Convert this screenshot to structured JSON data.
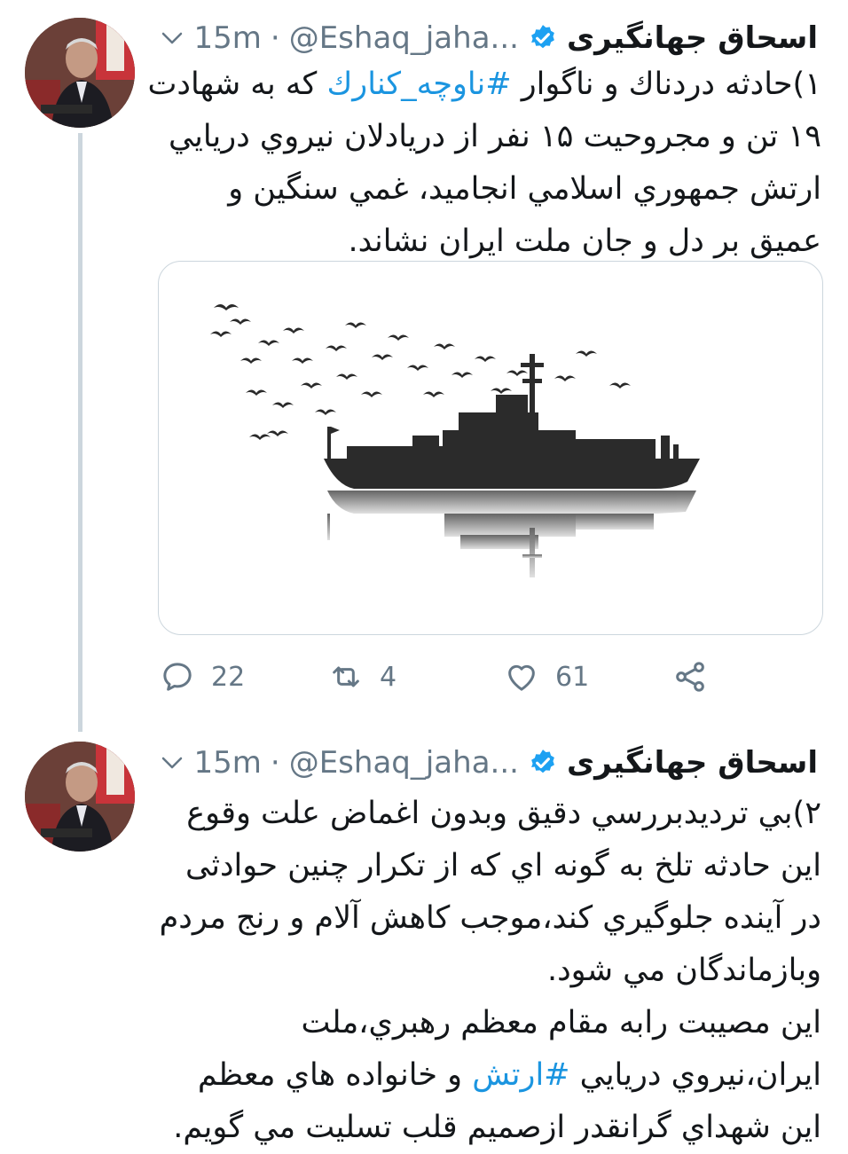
{
  "tweets": [
    {
      "author_name": "اسحاق جهانگیری",
      "handle": "@Eshaq_jaha...",
      "separator": "·",
      "time": "15m",
      "text_parts": [
        "۱)حادثه دردناك و ناگوار ",
        "#ناوچه_كنارك",
        " كه به شهادت ۱۹ تن و مجروحيت ۱۵ نفر از دريادلان نيروي دريايي ارتش جمهوري اسلامي انجاميد، غمي سنگين و عميق بر دل و جان ملت ايران نشاند."
      ],
      "media_icon": "warship-silhouette-with-birds",
      "actions": {
        "replies": "22",
        "retweets": "4",
        "likes": "61"
      }
    },
    {
      "author_name": "اسحاق جهانگیری",
      "handle": "@Eshaq_jaha...",
      "separator": "·",
      "time": "15m",
      "text_parts": [
        "۲)بي ترديدبررسي دقيق وبدون اغماض علت وقوع اين حادثه تلخ به گونه اي كه از تكرار چنين حوادثی در آينده جلوگيري كند،موجب كاهش آلام و رنج مردم وبازماندگان مي شود.",
        "اين مصيبت رابه مقام معظم رهبري،ملت ايران،نيروي دريايي ",
        "#ارتش",
        " و خانواده هاي معظم اين شهداي گرانقدر ازصميم قلب تسليت مي گويم."
      ]
    }
  ],
  "colors": {
    "link": "#1b95e0",
    "muted": "#657786",
    "verified": "#1da1f2",
    "thread_line": "#ccd6dd"
  }
}
